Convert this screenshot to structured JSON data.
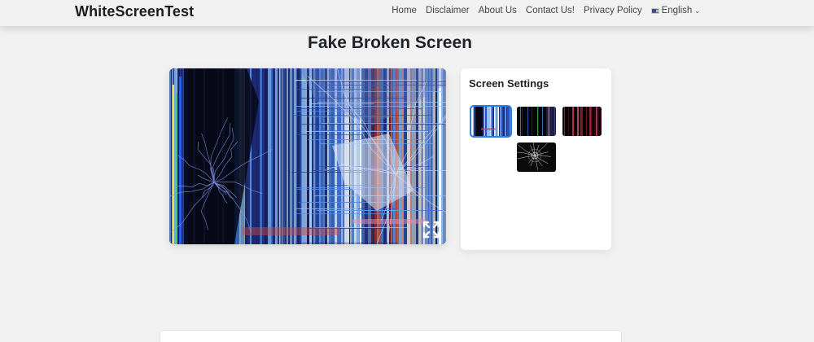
{
  "header": {
    "brand": "WhiteScreenTest",
    "nav": [
      {
        "label": "Home"
      },
      {
        "label": "Disclaimer"
      },
      {
        "label": "About Us"
      },
      {
        "label": "Contact Us!"
      },
      {
        "label": "Privacy Policy"
      }
    ],
    "language": {
      "label": "English",
      "flag_icon": "us-flag-icon",
      "chevron_icon": "chevron-down-icon"
    }
  },
  "main": {
    "title": "Fake Broken Screen",
    "preview": {
      "fullscreen_icon": "expand-icon"
    },
    "settings": {
      "title": "Screen Settings",
      "selected_index": 0,
      "options": [
        {
          "style": "broken-blue-stripes"
        },
        {
          "style": "dark-color-lines"
        },
        {
          "style": "dark-red-glitch"
        },
        {
          "style": "cracked-glass"
        }
      ]
    }
  },
  "colors": {
    "accent": "#2a7de1",
    "background": "#f1f1f1",
    "card": "#ffffff"
  }
}
